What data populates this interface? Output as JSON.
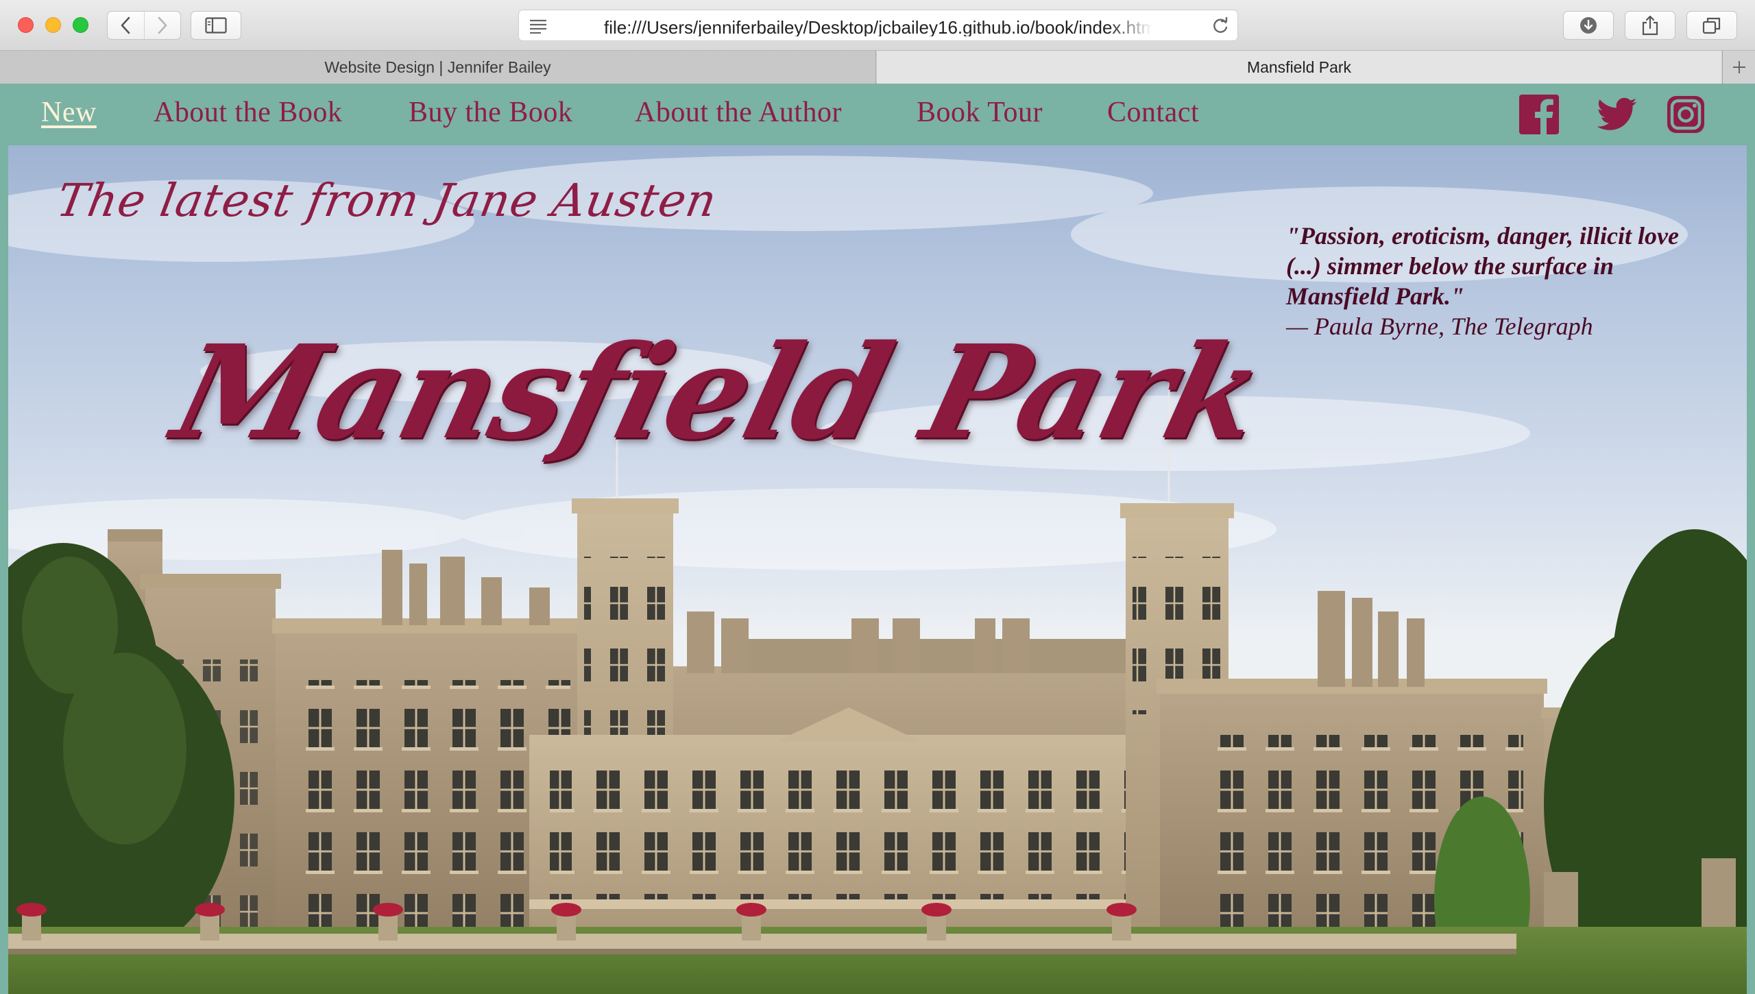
{
  "browser": {
    "url": "file:///Users/jenniferbailey/Desktop/jcbailey16.github.io/book/index.html",
    "tabs": [
      {
        "label": "Website Design | Jennifer Bailey",
        "active": false
      },
      {
        "label": "Mansfield Park",
        "active": true
      }
    ]
  },
  "nav": {
    "items": [
      {
        "label": "New",
        "current": true
      },
      {
        "label": "About the Book",
        "current": false
      },
      {
        "label": "Buy the Book",
        "current": false
      },
      {
        "label": "About the Author",
        "current": false
      },
      {
        "label": "Book Tour",
        "current": false
      },
      {
        "label": "Contact",
        "current": false
      }
    ],
    "social": [
      "facebook-icon",
      "twitter-icon",
      "instagram-icon"
    ]
  },
  "hero": {
    "tagline": "The latest from Jane Austen",
    "title": "Mansfield Park",
    "quote": {
      "text": "\"Passion, eroticism, danger, illicit love (...) simmer below the surface in Mansfield Park.\"",
      "attribution": "— Paula Byrne, The Telegraph"
    }
  },
  "colors": {
    "page_background": "#7ab2a4",
    "accent": "#8f1d45",
    "current_link": "#fbf3d8"
  }
}
